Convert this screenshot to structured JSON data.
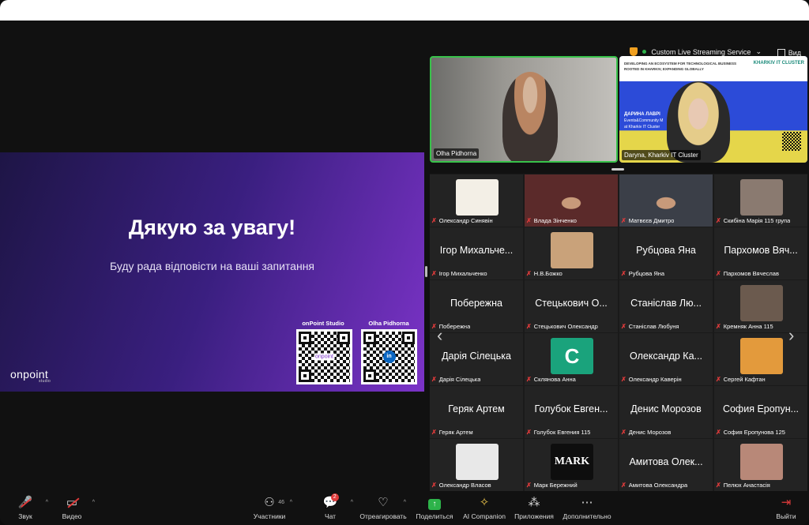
{
  "topbar": {
    "stream_label": "Custom Live Streaming Service",
    "view_label": "Вид"
  },
  "slide": {
    "title": "Дякую за увагу!",
    "subtitle": "Буду рада відповісти на ваші запитання",
    "logo": "onpoint",
    "logo_sub": "studio",
    "qr1_label": "onPoint Studio",
    "qr1_badge": "onpoint",
    "qr2_label": "Olha Pidhorna",
    "qr2_badge": "in"
  },
  "videos": [
    {
      "name": "Olha Pidhorna"
    },
    {
      "name": "Daryna, Kharkiv IT Cluster",
      "banner_line1": "DEVELOPING AN ECOSYSTEM FOR TECHNOLOGICAL BUSINESS",
      "banner_line2": "ROOTED IN KHARKIV, EXPANDING GLOBALLY",
      "logo": "KHARKIV IT CLUSTER",
      "overlay_name": "ДАРИНА ЛАВРІ",
      "overlay_role": "Events&Community M",
      "overlay_org": "at Kharkiv IT Cluster"
    }
  ],
  "gallery": [
    {
      "big": "",
      "label": "Олександр Синявін",
      "kind": "avatar",
      "color": "#f3efe6"
    },
    {
      "big": "",
      "label": "Влада Зінченко",
      "kind": "photo",
      "color": "#5b2a2a"
    },
    {
      "big": "",
      "label": "Матвєєв Дмитро",
      "kind": "photo",
      "color": "#3b3f48"
    },
    {
      "big": "",
      "label": "Скибіна Марія 115 група",
      "kind": "avatar",
      "color": "#8a7a70"
    },
    {
      "big": "Ігор Михальче...",
      "label": "Ігор Михальченко",
      "kind": "text"
    },
    {
      "big": "",
      "label": "Н.В.Божко",
      "kind": "avatar",
      "color": "#c9a27a"
    },
    {
      "big": "Рубцова Яна",
      "label": "Рубцова Яна",
      "kind": "text"
    },
    {
      "big": "Пархомов Вяч...",
      "label": "Пархомов Вячеслав",
      "kind": "text"
    },
    {
      "big": "Побережна",
      "label": "Побережна",
      "kind": "text"
    },
    {
      "big": "Стецькович О...",
      "label": "Стецькович Олександр",
      "kind": "text"
    },
    {
      "big": "Станіслав Лю...",
      "label": "Станіслав Любуня",
      "kind": "text"
    },
    {
      "big": "",
      "label": "Кремняк Анна 115",
      "kind": "avatar",
      "color": "#6b5a4e"
    },
    {
      "big": "Дарія Сілецька",
      "label": "Дарія Сілецька",
      "kind": "text"
    },
    {
      "big": "C",
      "label": "Склянова Анна",
      "kind": "letter",
      "color": "#1aa37c"
    },
    {
      "big": "Олександр Ка...",
      "label": "Олександр Каверін",
      "kind": "text"
    },
    {
      "big": "",
      "label": "Сергей Кафтан",
      "kind": "avatar",
      "color": "#e39a3c"
    },
    {
      "big": "Геряк Артем",
      "label": "Геряк Артем",
      "kind": "text"
    },
    {
      "big": "Голубок Евген...",
      "label": "Голубок Евгения 115",
      "kind": "text"
    },
    {
      "big": "Денис Морозов",
      "label": "Денис Морозов",
      "kind": "text"
    },
    {
      "big": "София Еропун...",
      "label": "София Еропунова 125",
      "kind": "text"
    },
    {
      "big": "",
      "label": "Олександр Власов",
      "kind": "avatar",
      "color": "#e8e8e8"
    },
    {
      "big": "MARK",
      "label": "Марк Бережний",
      "kind": "mark",
      "color": "#0e0e0e"
    },
    {
      "big": "Амитова Олек...",
      "label": "Амитова Олександра",
      "kind": "text"
    },
    {
      "big": "",
      "label": "Пелюх Анастасія",
      "kind": "avatar",
      "color": "#b88878"
    }
  ],
  "toolbar": {
    "audio": "Звук",
    "video": "Видео",
    "participants": "Участники",
    "participants_count": "46",
    "chat": "Чат",
    "chat_badge": "2",
    "react": "Отреагировать",
    "share": "Поделиться",
    "companion": "AI Companion",
    "apps": "Приложения",
    "more": "Дополнительно",
    "leave": "Выйти"
  },
  "colors": {
    "slide_start": "#1e1546",
    "slide_end": "#7b33c7",
    "active_border": "#38c24a",
    "muted": "#e03b3b"
  }
}
